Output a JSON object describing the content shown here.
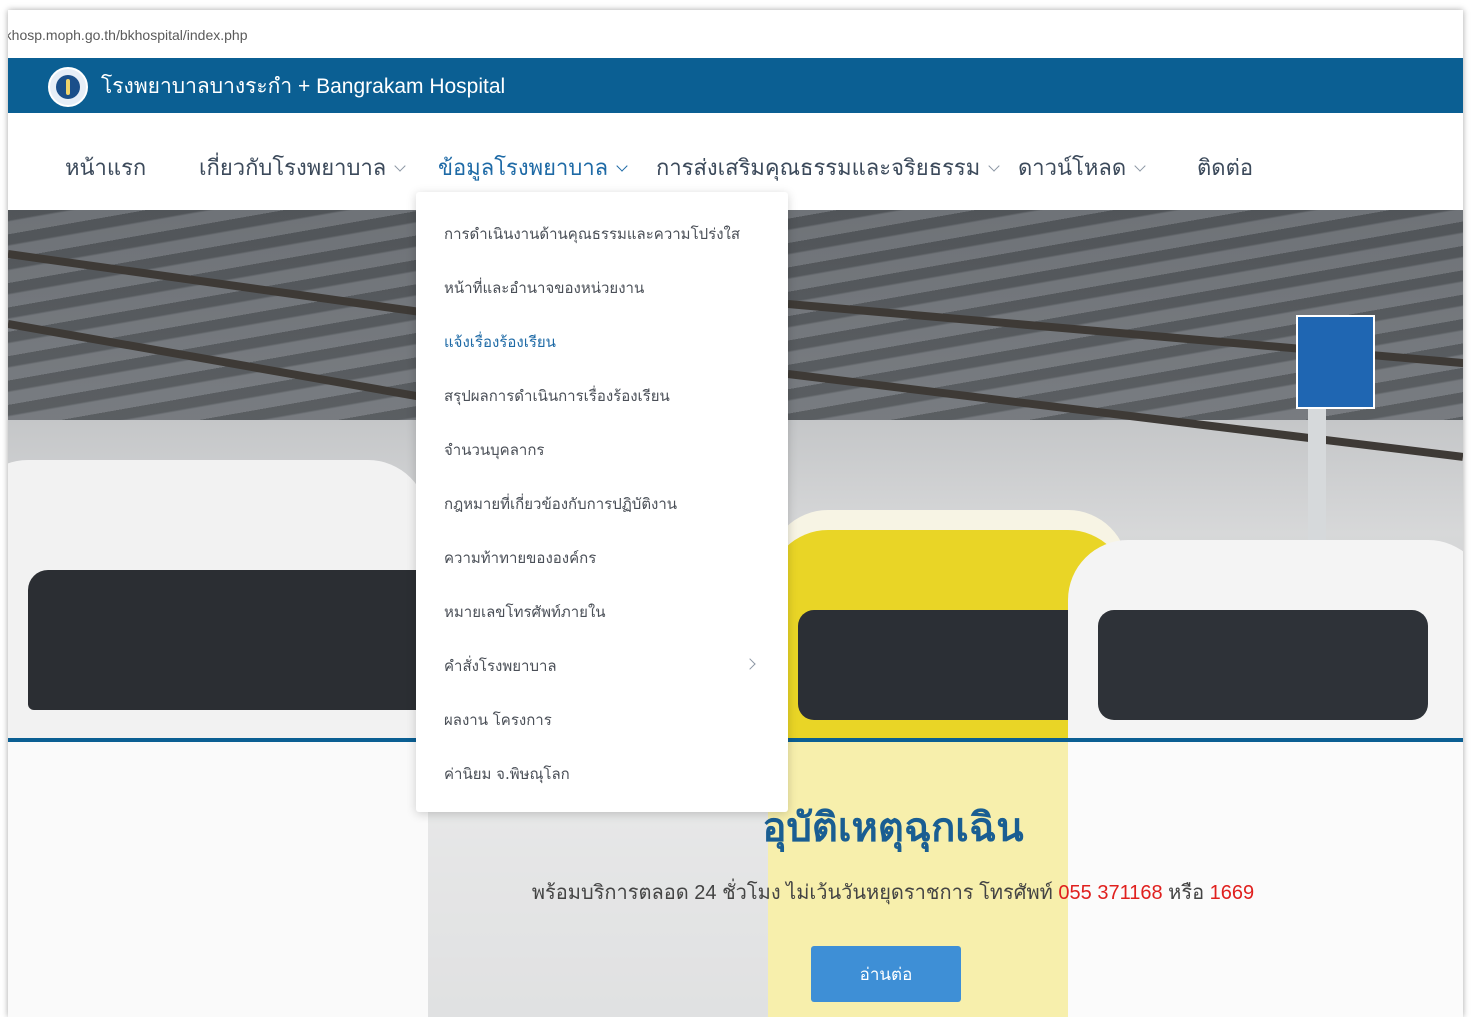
{
  "browser": {
    "url": "rkhosp.moph.go.th/bkhospital/index.php"
  },
  "site": {
    "title": "โรงพยาบาลบางระกำ + Bangrakam Hospital"
  },
  "nav": {
    "items": [
      {
        "label": "หน้าแรก"
      },
      {
        "label": "เกี่ยวกับโรงพยาบาล"
      },
      {
        "label": "ข้อมูลโรงพยาบาล"
      },
      {
        "label": "การส่งเสริมคุณธรรมและจริยธรรม"
      },
      {
        "label": "ดาวน์โหลด"
      },
      {
        "label": "ติดต่อ"
      }
    ]
  },
  "dropdown": {
    "items": [
      {
        "label": "การดำเนินงานด้านคุณธรรมและความโปร่งใส"
      },
      {
        "label": "หน้าที่และอำนาจของหน่วยงาน"
      },
      {
        "label": "แจ้งเรื่องร้องเรียน"
      },
      {
        "label": "สรุปผลการดำเนินการเรื่องร้องเรียน"
      },
      {
        "label": "จำนวนบุคลากร"
      },
      {
        "label": "กฎหมายที่เกี่ยวข้องกับการปฏิบัติงาน"
      },
      {
        "label": "ความท้าทายขององค์กร"
      },
      {
        "label": "หมายเลขโทรศัพท์ภายใน"
      },
      {
        "label": "คำสั่งโรงพยาบาล"
      },
      {
        "label": "ผลงาน โครงการ"
      },
      {
        "label": "ค่านิยม จ.พิษณุโลก"
      }
    ]
  },
  "hero": {
    "title": "อุบัติเหตุฉุกเฉิน",
    "subtitle_prefix": "พร้อมบริการตลอด 24 ชั่วโมง ไม่เว้นวันหยุดราชการ โทรศัพท์",
    "phone": "055 371168",
    "or": "หรือ",
    "hotline": "1669",
    "button": "อ่านต่อ"
  },
  "colors": {
    "brand": "#0b5f93",
    "accent": "#1e6aa6",
    "button": "#3e8fd6",
    "phone_red": "#e0201e"
  }
}
